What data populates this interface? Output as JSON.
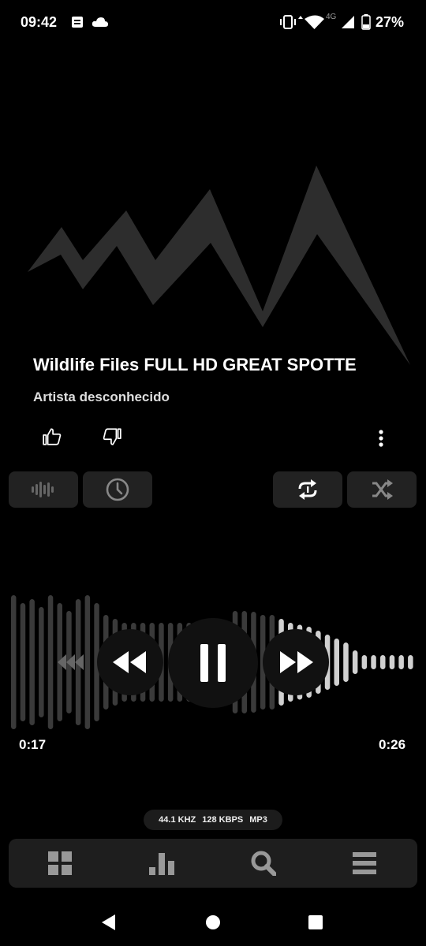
{
  "status_bar": {
    "time": "09:42",
    "network_label": "4G",
    "battery_text": "27%",
    "icons": [
      "notes-icon",
      "cloud-icon",
      "vibrate-icon",
      "wifi-icon",
      "signal-icon",
      "battery-icon"
    ]
  },
  "player": {
    "title": "Wildlife Files FULL HD GREAT SPOTTE",
    "artist": "Artista desconhecido",
    "elapsed": "0:17",
    "total": "0:26",
    "progress": 0.65,
    "format": {
      "sample_rate": "44.1 KHZ",
      "bitrate": "128 KBPS",
      "codec": "MP3"
    }
  },
  "actions": [
    "thumbs-up-icon",
    "thumbs-down-icon",
    "more-vert-icon"
  ],
  "toolbar": [
    "equalizer-icon",
    "sleep-timer-icon",
    "repeat-one-icon",
    "shuffle-icon"
  ],
  "bottom_nav": [
    "library-grid-icon",
    "charts-icon",
    "search-icon",
    "queue-list-icon"
  ],
  "system_nav": [
    "back-icon",
    "home-icon",
    "recents-icon"
  ],
  "colors": {
    "background": "#000000",
    "pill": "#222222",
    "bar_played": "#3a3a3a",
    "bar_unplayed": "#d0d0d0"
  }
}
